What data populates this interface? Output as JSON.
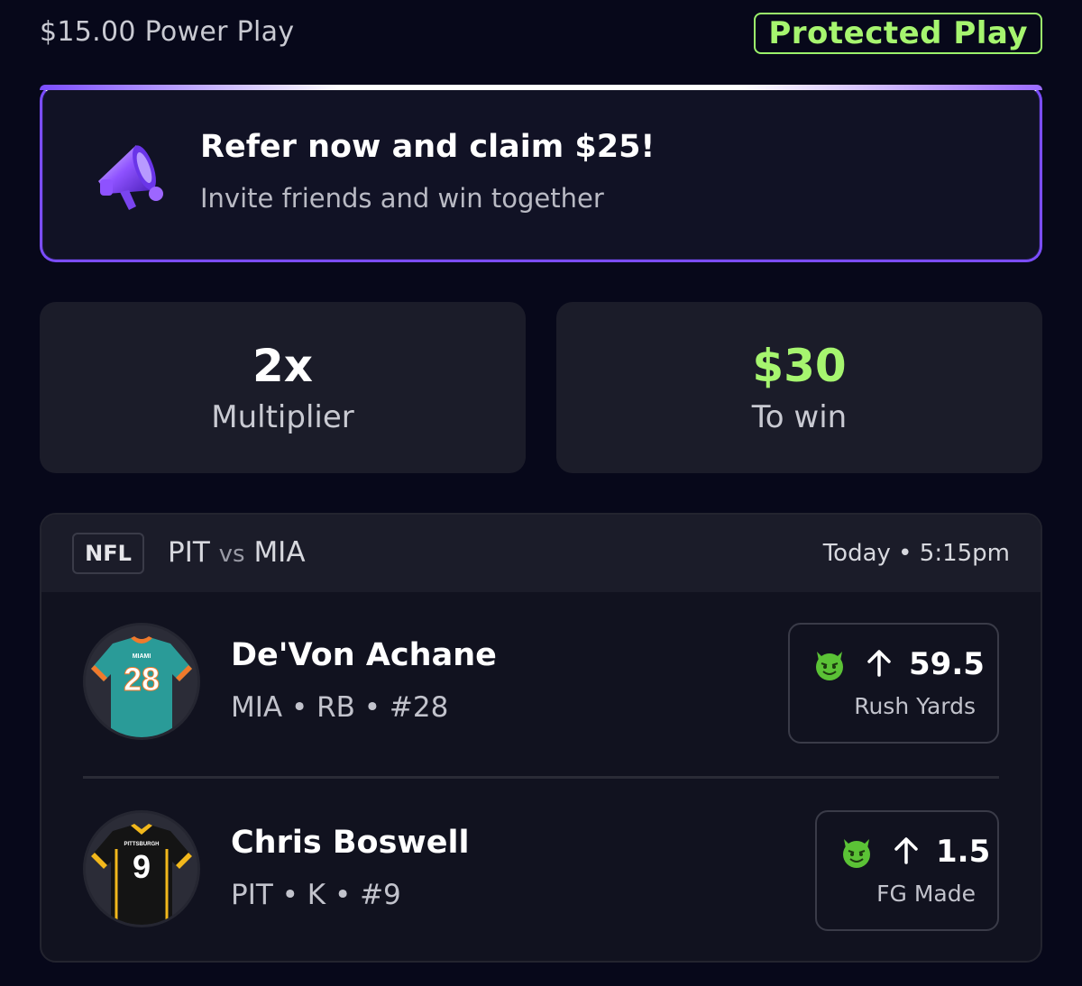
{
  "header": {
    "play_title": "$15.00 Power Play",
    "badge": "Protected Play"
  },
  "referral": {
    "title": "Refer now and claim $25!",
    "subtitle": "Invite friends and win together",
    "icon": "megaphone-icon"
  },
  "stats": {
    "multiplier_value": "2x",
    "multiplier_label": "Multiplier",
    "to_win_value": "$30",
    "to_win_label": "To win"
  },
  "game": {
    "league": "NFL",
    "team_a": "PIT",
    "vs": "vs",
    "team_b": "MIA",
    "time": "Today • 5:15pm"
  },
  "picks": [
    {
      "name": "De'Von Achane",
      "meta": "MIA • RB • #28",
      "jersey_text": "MIAMI",
      "jersey_number": "28",
      "direction": "up",
      "line": "59.5",
      "stat": "Rush Yards"
    },
    {
      "name": "Chris Boswell",
      "meta": "PIT • K • #9",
      "jersey_text": "PITTSBURGH",
      "jersey_number": "9",
      "direction": "up",
      "line": "1.5",
      "stat": "FG Made"
    }
  ],
  "colors": {
    "background": "#07081a",
    "accent_green": "#a6f56f",
    "accent_purple": "#7b4dff",
    "card": "#1b1c29"
  }
}
